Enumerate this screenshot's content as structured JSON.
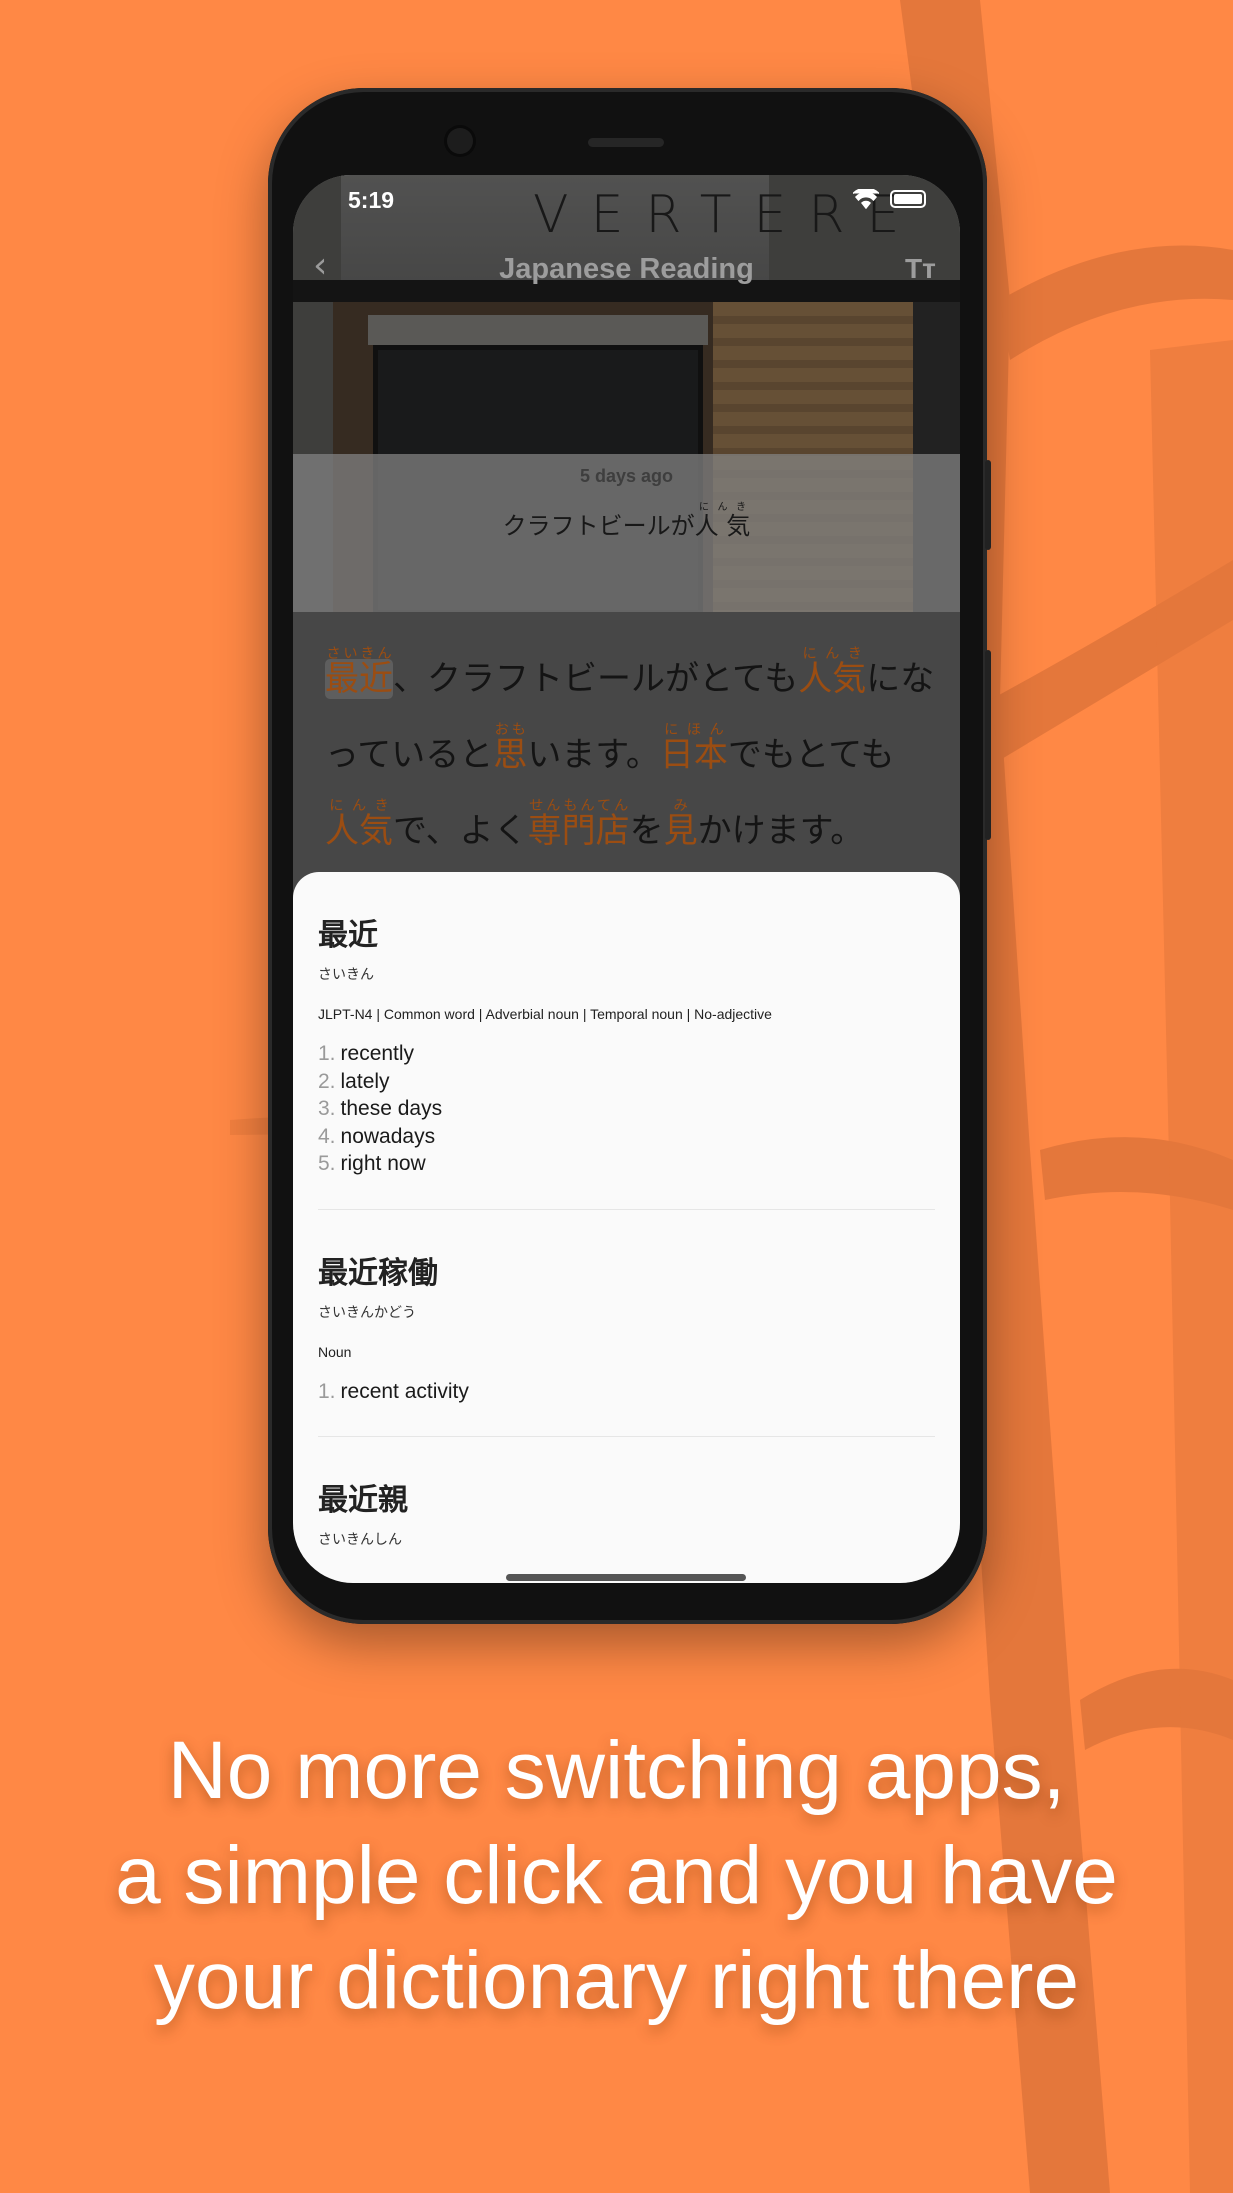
{
  "colors": {
    "background": "#ff8845",
    "keyword": "#9b4d12",
    "sheet": "#fafafa"
  },
  "status_bar": {
    "time": "5:19",
    "icons": [
      "wifi-icon",
      "battery-icon"
    ]
  },
  "header": {
    "back_icon": "chevron-left-icon",
    "title": "Japanese Reading",
    "text_size_icon": "Tт",
    "photo_sign": "VERTERE"
  },
  "article": {
    "date": "5 days ago",
    "title": [
      {
        "text": "クラフトビールが"
      },
      {
        "text": "人 気",
        "ruby": "にんき"
      }
    ],
    "body": [
      {
        "text": "最近",
        "ruby": "さいきん",
        "kw": true,
        "hl": true
      },
      {
        "text": "、クラフトビールがとても"
      },
      {
        "text": "人気",
        "ruby": "にんき",
        "kw": true
      },
      {
        "text": "になっていると"
      },
      {
        "text": "思",
        "ruby": "おも",
        "kw": true
      },
      {
        "text": "います。"
      },
      {
        "text": "日本",
        "ruby": "にほん",
        "kw": true
      },
      {
        "text": "でもとても"
      },
      {
        "text": "人気",
        "ruby": "にんき",
        "kw": true
      },
      {
        "text": "で、よく"
      },
      {
        "text": "専門店",
        "ruby": "せんもんてん",
        "kw": true
      },
      {
        "text": "を"
      },
      {
        "text": "見",
        "ruby": "み",
        "kw": true
      },
      {
        "text": "かけます。"
      }
    ]
  },
  "dictionary": [
    {
      "word": "最近",
      "reading": "さいきん",
      "tags": "JLPT-N4 | Common word | Adverbial noun | Temporal noun | No-adjective",
      "definitions": [
        "recently",
        "lately",
        "these days",
        "nowadays",
        "right now"
      ]
    },
    {
      "word": "最近稼働",
      "reading": "さいきんかどう",
      "tags": "Noun",
      "definitions": [
        "recent activity"
      ]
    },
    {
      "word": "最近親",
      "reading": "さいきんしん"
    }
  ],
  "caption": [
    "No more switching apps,",
    "a simple click and you have",
    "your dictionary right there"
  ]
}
